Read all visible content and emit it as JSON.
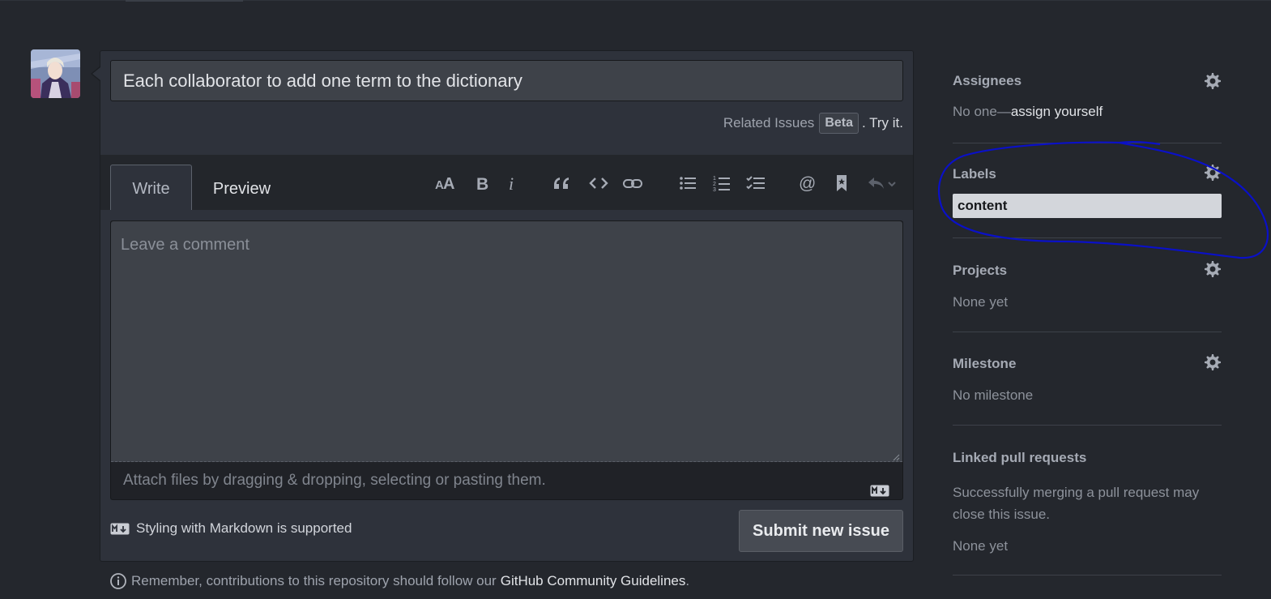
{
  "issue": {
    "title_value": "Each collaborator to add one term to the dictionary",
    "related_issues_label": "Related Issues",
    "beta_badge": "Beta",
    "try_it": ". Try it.",
    "tabs": {
      "write": "Write",
      "preview": "Preview"
    },
    "toolbar": [
      {
        "name": "text-size-icon",
        "glyph": "AA"
      },
      {
        "name": "bold-icon",
        "glyph": "B"
      },
      {
        "name": "italic-icon",
        "glyph": "i"
      },
      {
        "name": "quote-icon",
        "glyph": "“"
      },
      {
        "name": "code-icon",
        "glyph": "<>"
      },
      {
        "name": "link-icon",
        "glyph": "link"
      },
      {
        "name": "bulleted-list-icon",
        "glyph": "ul"
      },
      {
        "name": "numbered-list-icon",
        "glyph": "ol"
      },
      {
        "name": "task-list-icon",
        "glyph": "tasks"
      },
      {
        "name": "mention-icon",
        "glyph": "@"
      },
      {
        "name": "saved-reply-icon",
        "glyph": "bookmark"
      },
      {
        "name": "reply-icon",
        "glyph": "reply"
      }
    ],
    "comment_placeholder": "Leave a comment",
    "attach_text": "Attach files by dragging & dropping, selecting or pasting them.",
    "markdown_note": "Styling with Markdown is supported",
    "submit_label": "Submit new issue",
    "remember_text": "Remember, contributions to this repository should follow our",
    "guidelines_link": "GitHub Community Guidelines",
    "guidelines_period": "."
  },
  "sidebar": {
    "assignees": {
      "heading": "Assignees",
      "value_prefix": "No one—",
      "assign_link": "assign yourself"
    },
    "labels": {
      "heading": "Labels",
      "label": "content",
      "label_color": "#d3d6db"
    },
    "projects": {
      "heading": "Projects",
      "value": "None yet"
    },
    "milestone": {
      "heading": "Milestone",
      "value": "No milestone"
    },
    "linked_prs": {
      "heading": "Linked pull requests",
      "description_line1": "Successfully merging a pull request may",
      "description_line2": "close this issue.",
      "value": "None yet"
    }
  },
  "colors": {
    "background": "#24272d",
    "panel": "#2e323b",
    "annotation_stroke": "#0a10c8"
  }
}
